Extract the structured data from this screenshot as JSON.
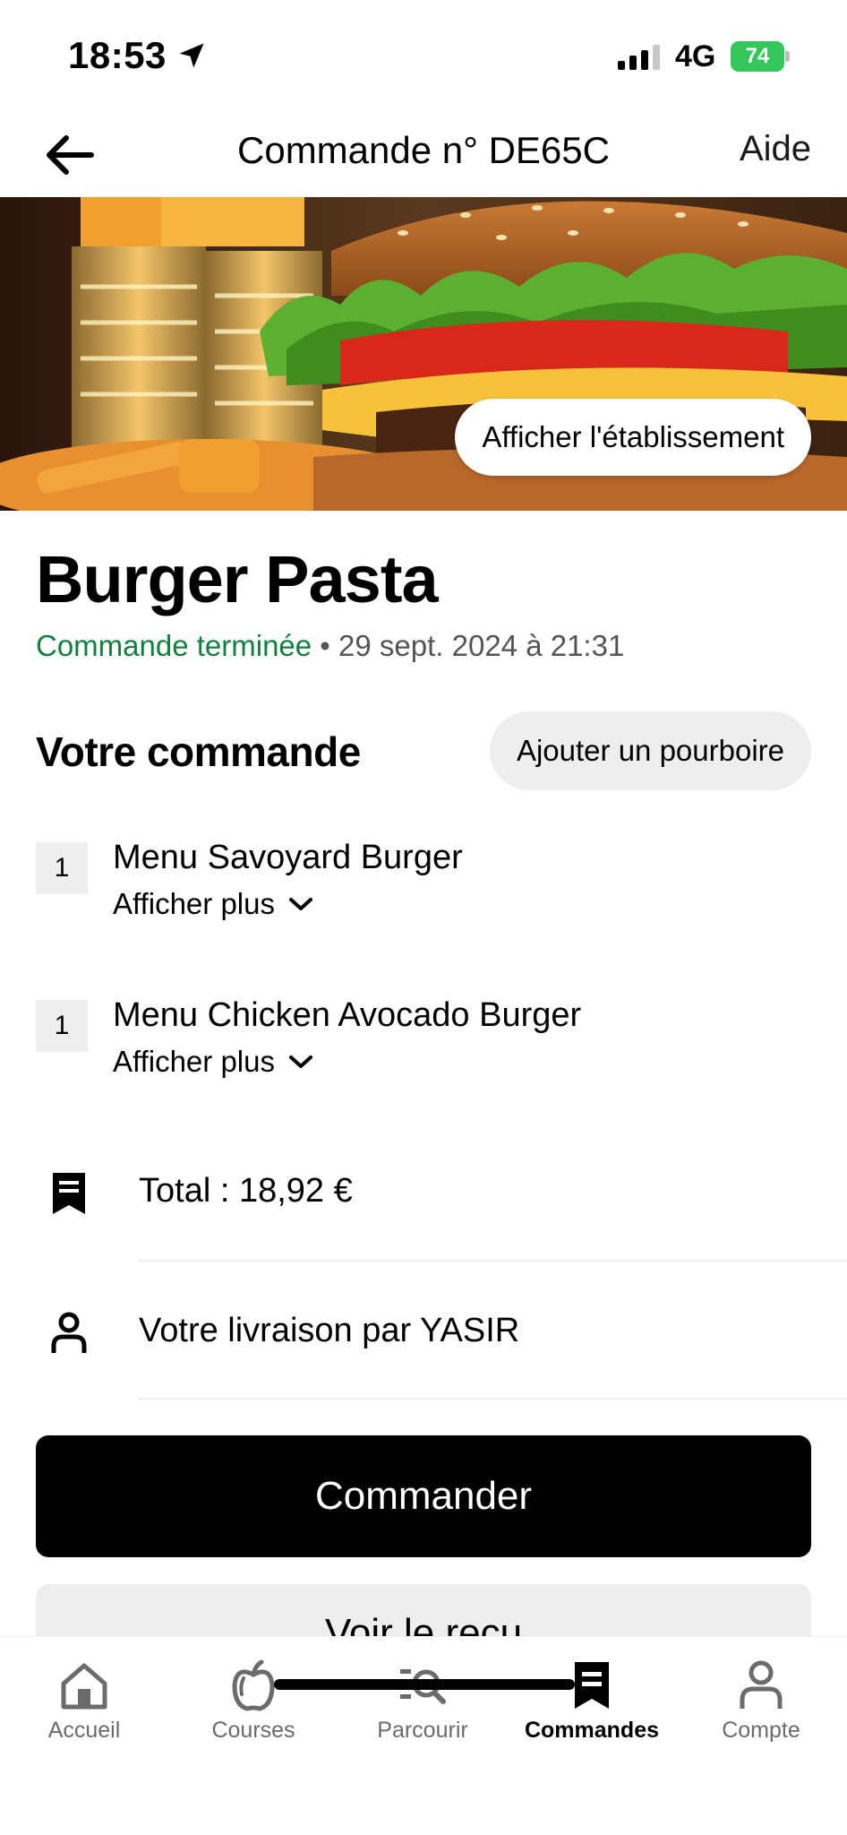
{
  "status_bar": {
    "time": "18:53",
    "network": "4G",
    "battery": "74"
  },
  "header": {
    "title": "Commande n° DE65C",
    "help_label": "Aide"
  },
  "hero": {
    "view_store_label": "Afficher l'établissement"
  },
  "restaurant": {
    "name": "Burger Pasta",
    "status": "Commande terminée",
    "separator": " • ",
    "datetime": "29 sept. 2024 à 21:31"
  },
  "order": {
    "section_title": "Votre commande",
    "tip_label": "Ajouter un pourboire",
    "items": [
      {
        "qty": "1",
        "name": "Menu Savoyard Burger",
        "more_label": "Afficher plus"
      },
      {
        "qty": "1",
        "name": "Menu Chicken Avocado Burger",
        "more_label": "Afficher plus"
      }
    ],
    "total_text": "Total : 18,92 €",
    "delivery_text": "Votre livraison par YASIR"
  },
  "actions": {
    "order_label": "Commander",
    "secondary_label": "Voir le reçu"
  },
  "tabs": [
    {
      "label": "Accueil",
      "icon": "home-icon"
    },
    {
      "label": "Courses",
      "icon": "apple-icon"
    },
    {
      "label": "Parcourir",
      "icon": "browse-search-icon"
    },
    {
      "label": "Commandes",
      "icon": "receipt-icon",
      "active": true
    },
    {
      "label": "Compte",
      "icon": "person-icon"
    }
  ],
  "colors": {
    "status_green": "#12803d",
    "primary": "#000000",
    "chip_bg": "#eeeeee"
  }
}
